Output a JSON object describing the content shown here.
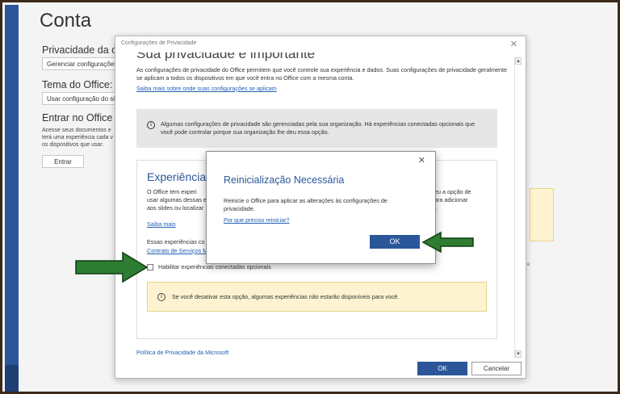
{
  "account_page": {
    "title": "Conta",
    "privacy_heading": "Privacidade da co",
    "privacy_button": "Gerenciar configurações",
    "theme_heading": "Tema do Office:",
    "theme_value": "Usar configuração do siste",
    "signin_heading": "Entrar no Office",
    "signin_desc": "Acesse seus documentos e\nterá uma experiência cada v\nos dispositivos que usar.",
    "signin_button": "Entrar"
  },
  "privacy_dialog": {
    "title": "Configurações de Privacidade",
    "heading": "Sua privacidade é importante",
    "intro": "As configurações de privacidade do Office permitem que você controle sua experiência e dados. Suas configurações de privacidade geralmente se aplicam a todos os dispositivos em que você entra no Office com a mesma conta.",
    "intro_link": "Saiba mais sobre onde suas configurações se aplicam",
    "info_text": "Algumas configurações de privacidade são gerenciadas pela sua organização. Há experiências conectadas opcionais que você pode controlar porque sua organização lhe deu essa opção.",
    "experiences_title": "Experiências",
    "experiences_desc_left": "O Office tem experi\nusar algumas dessas e\naos slides ou localizar",
    "experiences_desc_right": "deu a opção de\npara adicionar\nto.",
    "learn_more": "Saiba mais",
    "these_experiences": "Essas experiências co",
    "service_contract": "Contrato de Serviços M",
    "checkbox_label": "Habilitar experiências conectadas opcionais",
    "checkbox_checked": false,
    "warning_text": "Se você desativar esta opção, algumas experiências não estarão disponíveis para você.",
    "policy_link": "Política de Privacidade da Microsoft",
    "ok_label": "OK",
    "cancel_label": "Cancelar"
  },
  "restart_modal": {
    "title": "Reinicialização Necessária",
    "body": "Reinicie o Office para aplicar as alterações às configurações de privacidade.",
    "link": "Por que preciso reiniciar?",
    "ok_label": "OK"
  },
  "colors": {
    "accent": "#2b579a",
    "annotation_arrow": "#2e7d32",
    "warning_bg": "#fdf3d0"
  }
}
